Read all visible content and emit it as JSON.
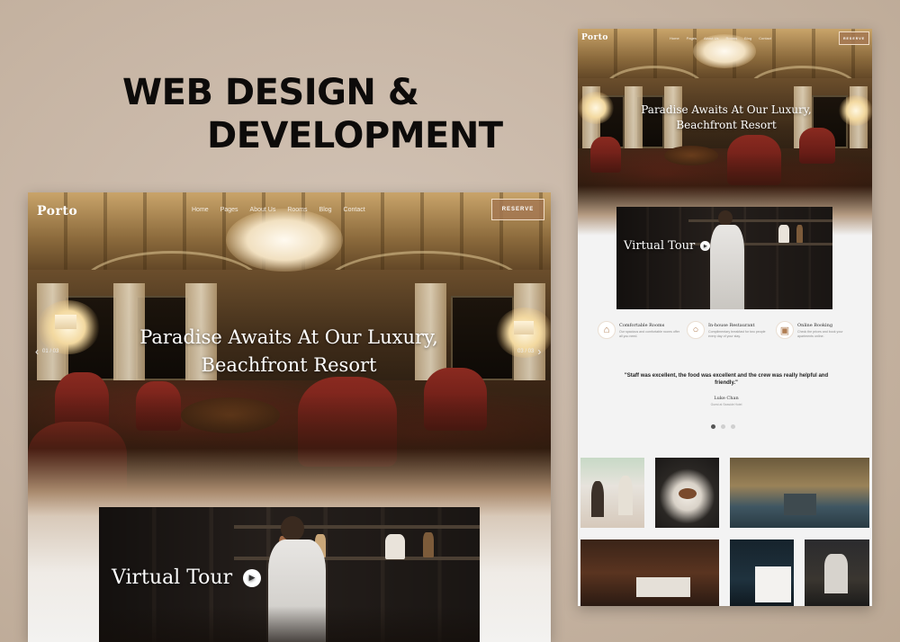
{
  "headline": {
    "line1": "WEB DESIGN &",
    "line2": "DEVELOPMENT"
  },
  "site": {
    "logo": "Porto",
    "nav": [
      "Home",
      "Pages",
      "About Us",
      "Rooms",
      "Blog",
      "Contact"
    ],
    "reserve_label": "RESERVE",
    "hero_title_line1": "Paradise Awaits At Our Luxury,",
    "hero_title_line2": "Beachfront Resort",
    "slide_prev": "01 / 03",
    "slide_next": "03 / 03",
    "virtual_tour_label": "Virtual Tour"
  },
  "features": [
    {
      "icon": "room-icon",
      "title": "Comfortable Rooms",
      "desc": "Our spacious and comfortable rooms offer all you need."
    },
    {
      "icon": "restaurant-icon",
      "title": "In-house Restaurant",
      "desc": "Complimentary breakfast for two people every day of your stay."
    },
    {
      "icon": "booking-icon",
      "title": "Online Booking",
      "desc": "Check the prices and book your apartments online."
    }
  ],
  "testimonial": {
    "quote": "\"Staff was excellent, the food was excellent and the crew was really helpful and friendly.\"",
    "author": "Luke Chan",
    "role": "Guest at Seaside Hotel"
  },
  "colors": {
    "accent": "#a47852",
    "background": "#c9b8a7",
    "headline": "#0d0b0a"
  }
}
